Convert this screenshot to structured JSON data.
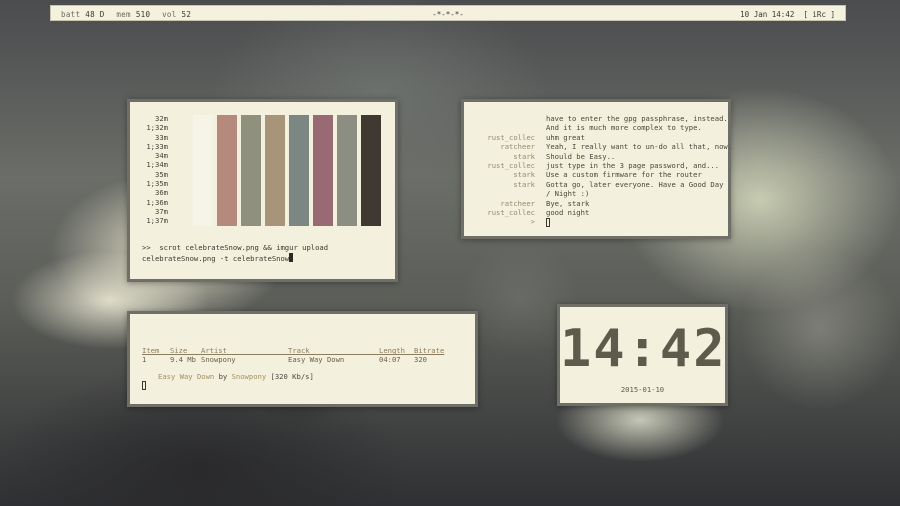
{
  "topbar": {
    "batt_label": "batt",
    "batt_value": "48 D",
    "mem_label": "mem",
    "mem_value": "510",
    "vol_label": "vol",
    "vol_value": "52",
    "center": "-*-*-*-",
    "datetime": "10 Jan 14:42",
    "tag": "[ iRc ]"
  },
  "palette": {
    "times": [
      "32m",
      "1;32m",
      "33m",
      "1;33m",
      "34m",
      "1;34m",
      "35m",
      "1;35m",
      "36m",
      "1;36m",
      "37m",
      "1;37m"
    ],
    "colors": [
      "#f6f4e6",
      "#b58a7d",
      "#8f907d",
      "#a89478",
      "#7c8682",
      "#9a6a74",
      "#8b8e80",
      "#3f3932"
    ],
    "prompt_symbol": ">>",
    "command": "scrot celebrateSnow.png && imgur upload celebrateSnow.png -t celebrateSnow"
  },
  "irc": {
    "lines": [
      {
        "nick": "",
        "msg": "have to enter the gpg passphrase, instead."
      },
      {
        "nick": "",
        "msg": "And it is much more complex to type."
      },
      {
        "nick": "rust_collec",
        "msg": "uhm great"
      },
      {
        "nick": "ratcheer",
        "msg": "Yeah, I really want to un-do all that, now."
      },
      {
        "nick": "stark",
        "msg": "Should be Easy.."
      },
      {
        "nick": "rust_collec",
        "msg": "just type in the 3 page password, and..."
      },
      {
        "nick": "stark",
        "msg": "Use a custom firmware for the router"
      },
      {
        "nick": "stark",
        "msg": "Gotta go, later everyone. Have a Good Day"
      },
      {
        "nick": "",
        "msg": "/ Night :)"
      },
      {
        "nick": "ratcheer",
        "msg": "Bye, stark"
      },
      {
        "nick": "rust_collec",
        "msg": "good night"
      },
      {
        "nick": ">",
        "msg": ""
      }
    ]
  },
  "music": {
    "headers": [
      "Item",
      "Size",
      "Artist",
      "Track",
      "Length",
      "Bitrate"
    ],
    "row": [
      "1",
      "9.4 Mb",
      "Snowpony",
      "Easy Way Down",
      "04:07",
      "320"
    ],
    "now_track": "Easy Way Down",
    "by": "by",
    "now_artist": "Snowpony",
    "bitrate": "[320 Kb/s]"
  },
  "clock": {
    "time": "14:42",
    "date": "2015-01-10"
  }
}
